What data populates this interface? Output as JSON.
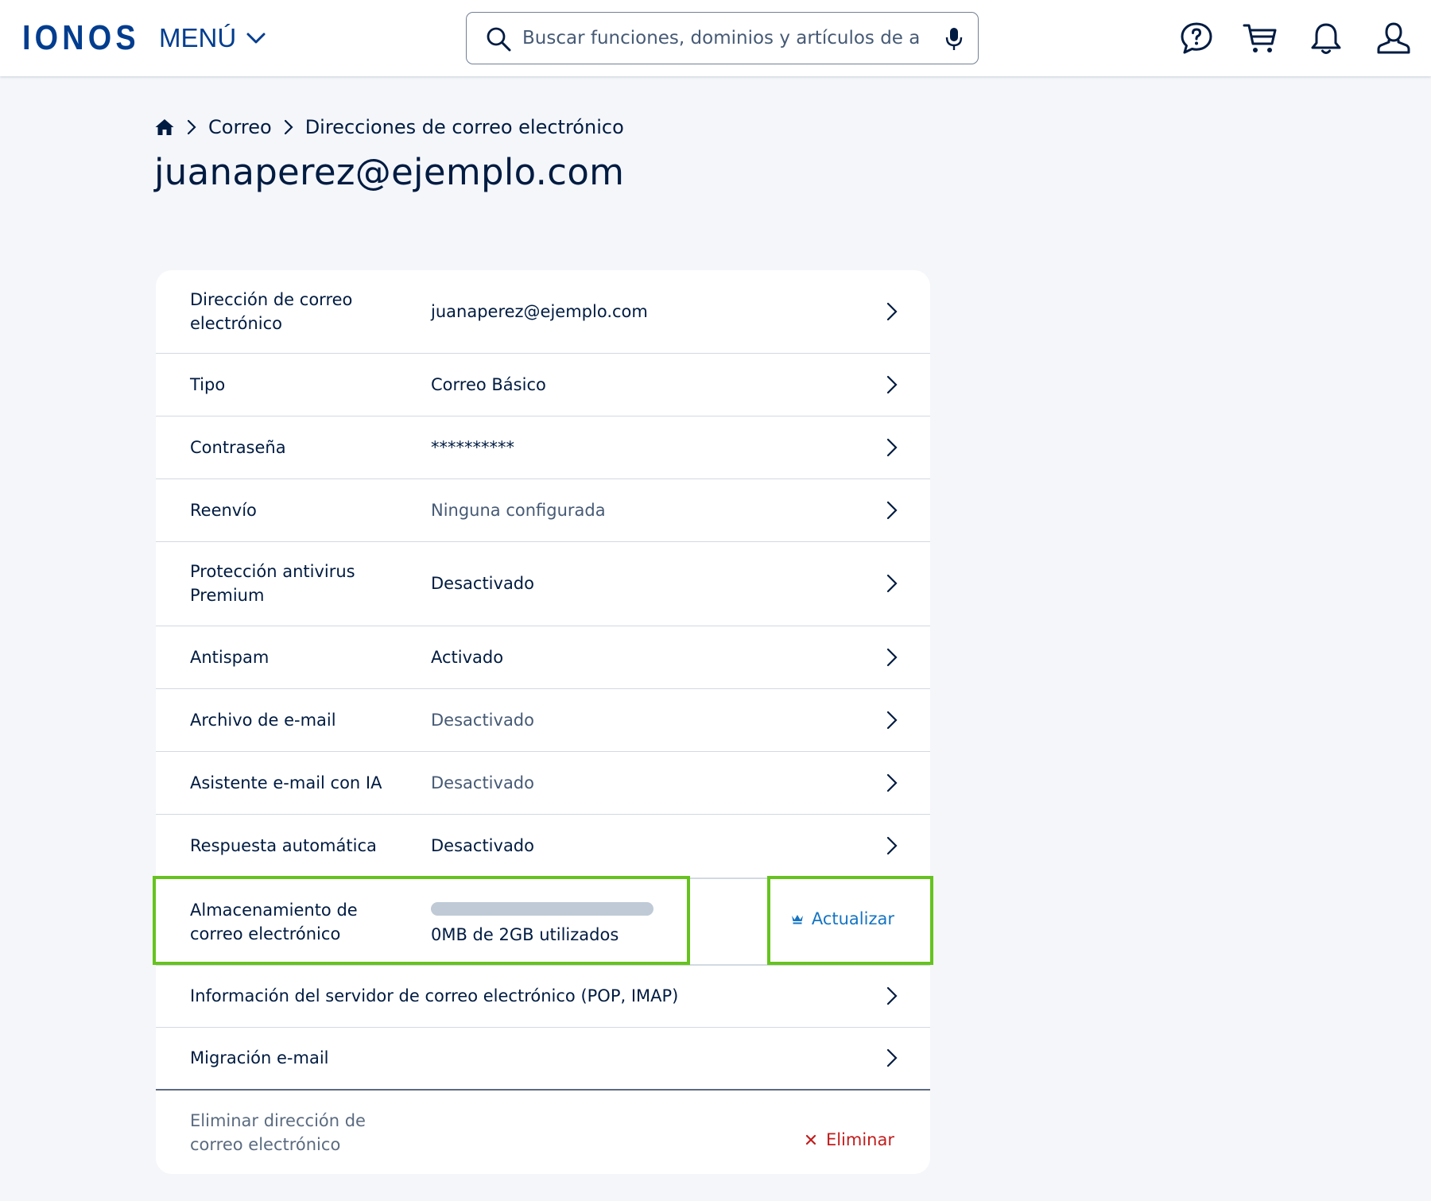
{
  "header": {
    "logo_text": "IONOS",
    "menu_label": "MENÚ",
    "search_placeholder": "Buscar funciones, dominios y artículos de ay…",
    "icons": [
      "help-chat-icon",
      "cart-icon",
      "bell-icon",
      "user-icon"
    ]
  },
  "breadcrumb": {
    "items": [
      "Correo",
      "Direcciones de correo electrónico"
    ]
  },
  "page_title": "juanaperez@ejemplo.com",
  "rows": [
    {
      "label": "Dirección de correo electrónico",
      "value": "juanaperez@ejemplo.com",
      "muted": false
    },
    {
      "label": "Tipo",
      "value": "Correo Básico",
      "muted": false
    },
    {
      "label": "Contraseña",
      "value": "**********",
      "muted": false
    },
    {
      "label": "Reenvío",
      "value": "Ninguna configurada",
      "muted": true
    },
    {
      "label": "Protección antivirus Premium",
      "value": "Desactivado",
      "muted": false
    },
    {
      "label": "Antispam",
      "value": "Activado",
      "muted": false
    },
    {
      "label": "Archivo de e-mail",
      "value": "Desactivado",
      "muted": true
    },
    {
      "label": "Asistente e-mail con IA",
      "value": "Desactivado",
      "muted": true
    },
    {
      "label": "Respuesta automática",
      "value": "Desactivado",
      "muted": false
    }
  ],
  "storage": {
    "label": "Almacenamiento de correo electrónico",
    "usage_text": "0MB de 2GB utilizados",
    "used_fraction": 0,
    "upgrade_label": "Actualizar"
  },
  "server_info_label": "Información del servidor de correo electrónico (POP, IMAP)",
  "migration_label": "Migración e-mail",
  "delete_row": {
    "label": "Eliminar dirección de correo electrónico",
    "action_label": "Eliminar"
  },
  "colors": {
    "brand": "#003d8f",
    "text": "#001b41",
    "muted": "#465a75",
    "link": "#1474c4",
    "danger": "#c21c1c",
    "highlight": "#66c31e"
  }
}
